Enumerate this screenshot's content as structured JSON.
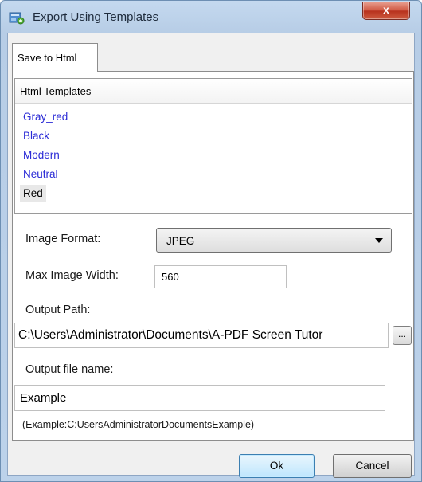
{
  "window": {
    "title": "Export Using Templates",
    "close_label": "x"
  },
  "tabs": [
    {
      "label": "Save to Html",
      "selected": true
    }
  ],
  "templates": {
    "header": "Html Templates",
    "items": [
      "Gray_red",
      "Black",
      "Modern",
      "Neutral",
      "Red"
    ],
    "selected": "Red"
  },
  "image_format": {
    "label": "Image Format:",
    "value": "JPEG"
  },
  "max_width": {
    "label": "Max Image Width:",
    "value": "560"
  },
  "output_path": {
    "label": "Output Path:",
    "value": "C:\\Users\\Administrator\\Documents\\A-PDF Screen Tutor",
    "browse_label": "..."
  },
  "output_name": {
    "label": "Output file name:",
    "value": "Example",
    "hint": "(Example:C:UsersAdministratorDocumentsExample)"
  },
  "buttons": {
    "ok": "Ok",
    "cancel": "Cancel"
  },
  "colors": {
    "link_blue": "#2a2ad6",
    "frame_blue": "#b7cde6",
    "close_red": "#c7452e"
  },
  "icons": {
    "app": "export-templates-icon",
    "close": "close-icon",
    "dropdown": "chevron-down-icon"
  }
}
